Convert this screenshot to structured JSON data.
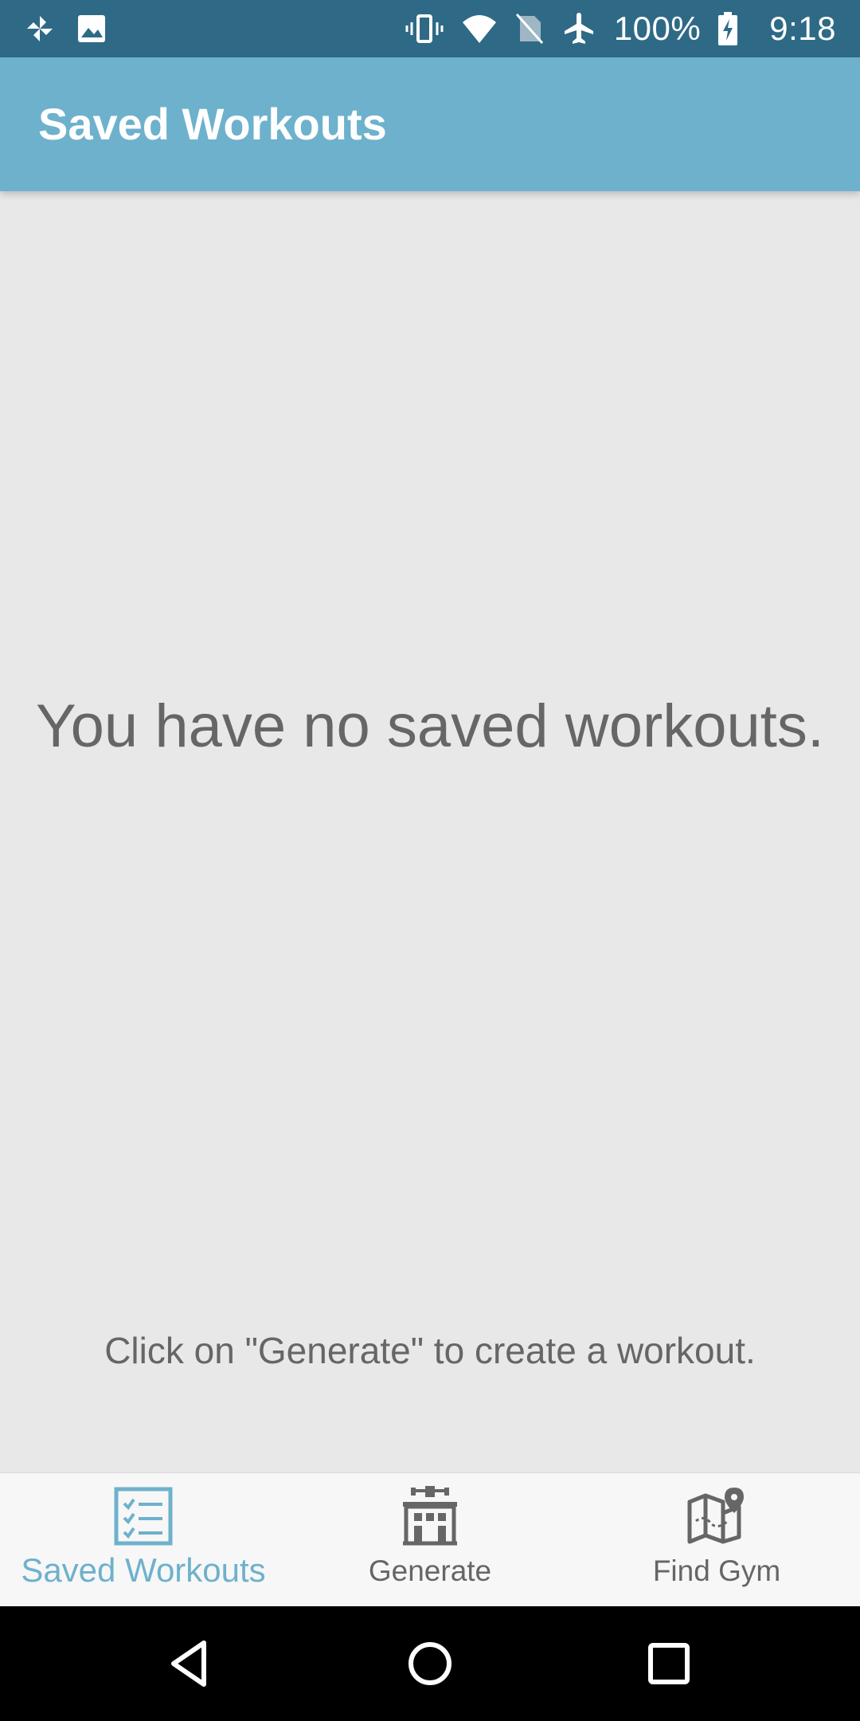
{
  "status_bar": {
    "battery": "100%",
    "time": "9:18",
    "icons": [
      "pinwheel-icon",
      "image-icon",
      "vibrate-icon",
      "wifi-icon",
      "no-sim-icon",
      "airplane-icon",
      "battery-charging-icon"
    ]
  },
  "app_bar": {
    "title": "Saved Workouts"
  },
  "content": {
    "empty_title": "You have no saved workouts.",
    "empty_hint": "Click on \"Generate\" to create a workout."
  },
  "bottom_nav": {
    "items": [
      {
        "label": "Saved Workouts",
        "icon": "checklist-icon",
        "active": true
      },
      {
        "label": "Generate",
        "icon": "gym-building-icon",
        "active": false
      },
      {
        "label": "Find Gym",
        "icon": "map-pin-icon",
        "active": false
      }
    ]
  },
  "system_nav": {
    "icons": [
      "back-icon",
      "home-icon",
      "recents-icon"
    ]
  },
  "colors": {
    "status_bar": "#2e6a86",
    "app_bar": "#6eb1cc",
    "background": "#e8e8e8",
    "accent": "#6eb1cc",
    "text_gray": "#666666",
    "nav_bg": "#f7f7f7"
  }
}
